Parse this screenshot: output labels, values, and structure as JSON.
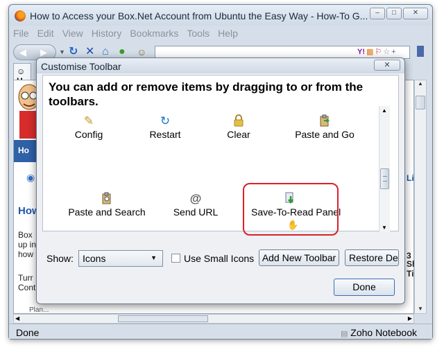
{
  "window": {
    "title": "How to Access your Box.Net Account from Ubuntu the Easy Way - How-To G...",
    "minimize_icon": "–",
    "restore_icon": "□",
    "close_icon": "✕"
  },
  "menubar": [
    "File",
    "Edit",
    "View",
    "History",
    "Bookmarks",
    "Tools",
    "Help"
  ],
  "statusbar": {
    "status": "Done",
    "addon": "Zoho Notebook"
  },
  "background_page": {
    "tab_label": "H",
    "nav_label": "Ho",
    "heading": "How",
    "lines": [
      "Box",
      "up in",
      "how",
      "Turr",
      "Cont"
    ],
    "right_label": "Li",
    "right_side": "3",
    "right_side2": "Sh",
    "right_side3": "Ti",
    "footer_fragment": "Plan..."
  },
  "dialog": {
    "title": "Customise Toolbar",
    "close_icon": "✕",
    "heading": "You can add or remove items by dragging to or from the toolbars.",
    "items": [
      {
        "label": "Config",
        "icon": "config-icon",
        "glyph": "✎",
        "color": "#c9932a"
      },
      {
        "label": "Restart",
        "icon": "restart-icon",
        "glyph": "↻",
        "color": "#1a73c9"
      },
      {
        "label": "Clear",
        "icon": "lock-icon",
        "glyph": "ὑ2",
        "color": "#c7a33a"
      },
      {
        "label": "Paste and Go",
        "icon": "paste-go-icon",
        "glyph": "⎘",
        "color": "#6b8f3a"
      },
      {
        "label": "Paste and Search",
        "icon": "paste-search-icon",
        "glyph": "⌕",
        "color": "#5b6f8a"
      },
      {
        "label": "Send URL",
        "icon": "at-icon",
        "glyph": "@",
        "color": "#555555"
      },
      {
        "label": "Save-To-Read Panel",
        "icon": "save-to-read-icon",
        "glyph": "⇩",
        "color": "#2f9b3a"
      }
    ],
    "show_label": "Show:",
    "show_value": "Icons",
    "small_icons_label": "Use Small Icons",
    "small_icons_checked": false,
    "add_toolbar_label": "Add New Toolbar",
    "restore_label": "Restore Default Set",
    "done_label": "Done"
  },
  "colors": {
    "highlight_border": "#d9202a",
    "nav_blue": "#2e61a6"
  }
}
